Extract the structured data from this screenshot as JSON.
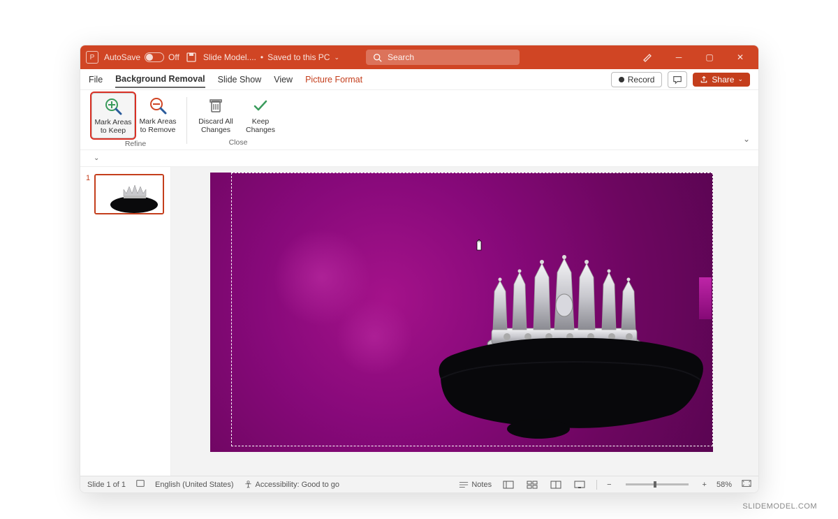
{
  "titlebar": {
    "autosave_label": "AutoSave",
    "autosave_state": "Off",
    "doc_name": "Slide Model....",
    "save_state": "Saved to this PC",
    "search_placeholder": "Search"
  },
  "tabs": {
    "file": "File",
    "bg_removal": "Background Removal",
    "slide_show": "Slide Show",
    "view": "View",
    "picture_format": "Picture Format"
  },
  "tab_right": {
    "record": "Record",
    "share": "Share"
  },
  "ribbon": {
    "mark_keep": "Mark Areas to Keep",
    "mark_remove": "Mark Areas to Remove",
    "discard": "Discard All Changes",
    "keep": "Keep Changes",
    "group_refine": "Refine",
    "group_close": "Close"
  },
  "thumbs": {
    "num1": "1"
  },
  "statusbar": {
    "slide_pos": "Slide 1 of 1",
    "language": "English (United States)",
    "accessibility": "Accessibility: Good to go",
    "notes": "Notes",
    "zoom": "58%"
  },
  "attribution": "SLIDEMODEL.COM"
}
